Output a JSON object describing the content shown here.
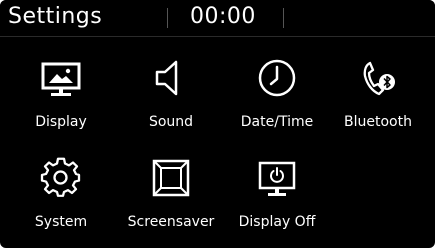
{
  "header": {
    "title": "Settings",
    "clock": "00:00"
  },
  "menu": {
    "items": [
      {
        "label": "Display",
        "icon": "display-icon"
      },
      {
        "label": "Sound",
        "icon": "speaker-icon"
      },
      {
        "label": "Date/Time",
        "icon": "clock-icon"
      },
      {
        "label": "Bluetooth",
        "icon": "bluetooth-phone-icon"
      },
      {
        "label": "System",
        "icon": "gear-icon"
      },
      {
        "label": "Screensaver",
        "icon": "screensaver-icon"
      },
      {
        "label": "Display Off",
        "icon": "display-off-icon"
      }
    ]
  },
  "colors": {
    "background": "#000000",
    "text": "#ffffff"
  }
}
